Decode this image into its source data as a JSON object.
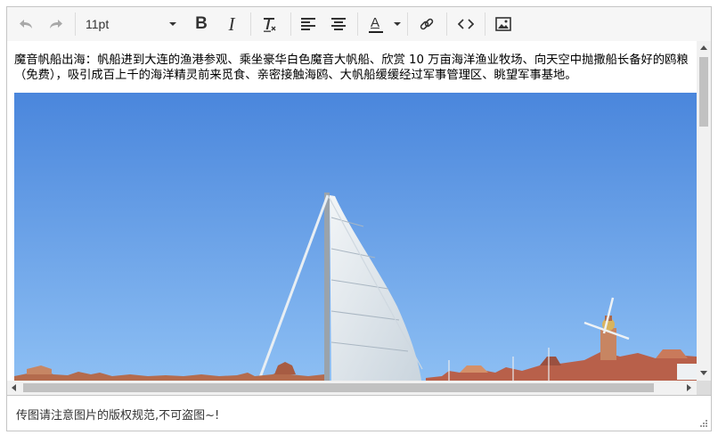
{
  "toolbar": {
    "font_size": "11pt",
    "icons": [
      "undo-icon",
      "redo-icon",
      "bold-icon",
      "italic-icon",
      "clear-formatting-icon",
      "align-left-icon",
      "align-center-icon",
      "text-color-icon",
      "link-icon",
      "source-code-icon",
      "image-icon"
    ],
    "bold_glyph": "B",
    "italic_glyph": "I",
    "text_color_glyph": "A",
    "text_color": "#222222"
  },
  "content": {
    "paragraph": "魔音帆船出海：帆船进到大连的渔港参观、乘坐豪华白色魔音大帆船、欣赏 10 万亩海洋渔业牧场、向天空中抛撒船长备好的鸥粮（免费），吸引成百上千的海洋精灵前来觅食、亲密接触海鸥、大帆船缓缓经过军事管理区、眺望军事基地。",
    "image": "sailboat-photo"
  },
  "statusbar": {
    "text": "传图请注意图片的版权规范,不可盗图~!"
  },
  "colors": {
    "toolbar_bg": "#f6f6f6",
    "border": "#c5c5c5",
    "sky": "#4f8fe0",
    "sail": "#e6ebef"
  }
}
